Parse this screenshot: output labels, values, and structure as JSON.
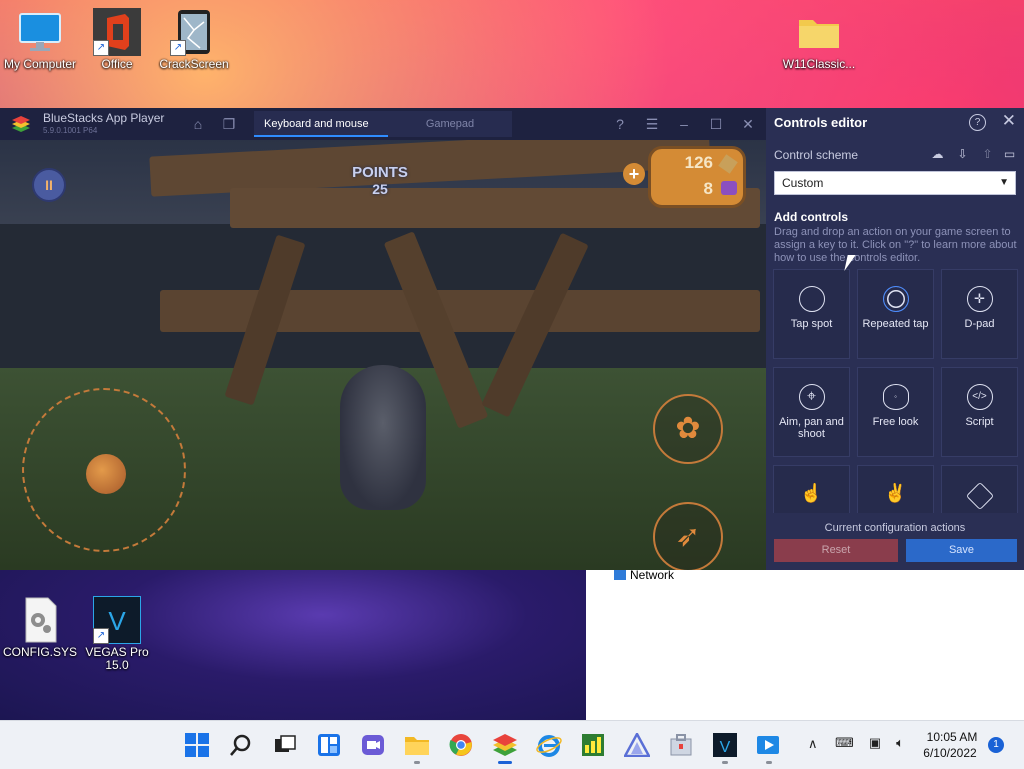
{
  "desktop": {
    "icons": [
      {
        "label": "My Computer"
      },
      {
        "label": "Office"
      },
      {
        "label": "CrackScreen"
      },
      {
        "label": "W11Classic..."
      },
      {
        "label": "CONFIG.SYS"
      },
      {
        "label": "VEGAS Pro 15.0"
      }
    ],
    "explorer_remnant": {
      "network_label": "Network"
    }
  },
  "bluestacks": {
    "title": "BlueStacks App Player",
    "subtitle": "5.9.0.1001 P64",
    "tabs": [
      {
        "label": "Keyboard and mouse",
        "active": true
      },
      {
        "label": "Gamepad",
        "active": false
      }
    ],
    "game": {
      "points_label": "POINTS",
      "points_value": "25",
      "coins": "126",
      "gems": "8",
      "pause_label": "II",
      "plus_label": "+"
    }
  },
  "controls_editor": {
    "title": "Controls editor",
    "help_label": "?",
    "close_label": "✕",
    "control_scheme_label": "Control scheme",
    "control_scheme_value": "Custom",
    "add_controls_title": "Add controls",
    "add_controls_desc": "Drag and drop an action on your game screen to assign a key to it. Click on \"?\" to learn more about how to use the controls editor.",
    "tiles": [
      {
        "label": "Tap spot",
        "icon": "circle-icon"
      },
      {
        "label": "Repeated tap",
        "icon": "double-circle-icon"
      },
      {
        "label": "D-pad",
        "icon": "dpad-icon"
      },
      {
        "label": "Aim, pan and shoot",
        "icon": "crosshair-icon"
      },
      {
        "label": "Free look",
        "icon": "eye-icon"
      },
      {
        "label": "Script",
        "icon": "code-icon"
      },
      {
        "label": "",
        "icon": "swipe-icon"
      },
      {
        "label": "",
        "icon": "gesture-icon"
      },
      {
        "label": "",
        "icon": "rotate-icon"
      }
    ],
    "current_config_label": "Current configuration actions",
    "reset_label": "Reset",
    "save_label": "Save"
  },
  "taskbar": {
    "time": "10:05 AM",
    "date": "6/10/2022",
    "notification_count": "1",
    "accent": "#1a62d6"
  }
}
